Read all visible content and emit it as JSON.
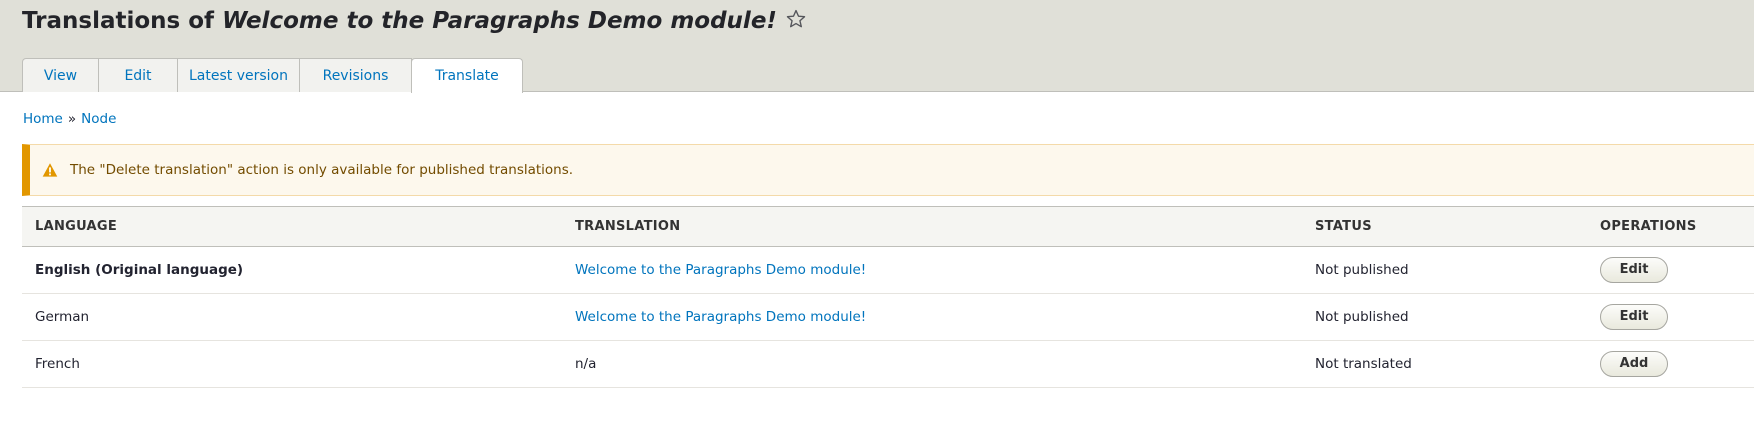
{
  "header": {
    "title_prefix": "Translations of ",
    "title_node": "Welcome to the Paragraphs Demo module!",
    "tabs": [
      {
        "label": "View",
        "active": false
      },
      {
        "label": "Edit",
        "active": false
      },
      {
        "label": "Latest version",
        "active": false
      },
      {
        "label": "Revisions",
        "active": false
      },
      {
        "label": "Translate",
        "active": true
      }
    ]
  },
  "breadcrumb": {
    "items": [
      "Home",
      "Node"
    ],
    "separator": "»"
  },
  "message": {
    "type": "warning",
    "icon": "warning-icon",
    "text": "The \"Delete translation\" action is only available for published translations."
  },
  "table": {
    "headers": {
      "language": "LANGUAGE",
      "translation": "TRANSLATION",
      "status": "STATUS",
      "operations": "OPERATIONS"
    },
    "rows": [
      {
        "language": "English (Original language)",
        "translation": "Welcome to the Paragraphs Demo module!",
        "status": "Not published",
        "operation": "Edit"
      },
      {
        "language": "German",
        "translation": "Welcome to the Paragraphs Demo module!",
        "status": "Not published",
        "operation": "Edit"
      },
      {
        "language": "French",
        "translation": "n/a",
        "status": "Not translated",
        "operation": "Add"
      }
    ]
  },
  "colors": {
    "link": "#0074bd",
    "header_bg": "#e0e0d8",
    "warning_accent": "#e29700",
    "warning_bg": "#fdf8ed",
    "warning_text": "#734c00"
  }
}
